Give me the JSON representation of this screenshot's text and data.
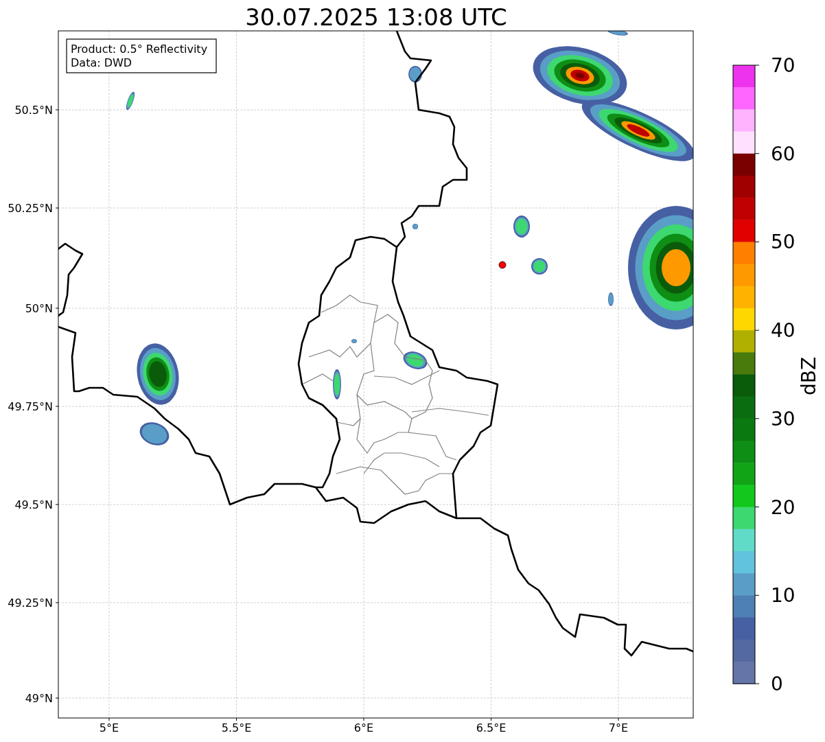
{
  "title": "30.07.2025 13:08 UTC",
  "info_box": [
    "Product: 0.5° Reflectivity",
    "Data: DWD"
  ],
  "map": {
    "x_ticks": [
      "5°E",
      "5.5°E",
      "6°E",
      "6.5°E",
      "7°E"
    ],
    "y_ticks": [
      "50.5°N",
      "50.25°N",
      "50°N",
      "49.75°N",
      "49.5°N",
      "49.25°N",
      "49°N"
    ]
  },
  "colorbar": {
    "label": "dBZ",
    "ticks": [
      "70",
      "60",
      "50",
      "40",
      "30",
      "20",
      "10",
      "0"
    ],
    "levels": [
      {
        "color": "#ee33ee"
      },
      {
        "color": "#ff66ff"
      },
      {
        "color": "#ffb3ff"
      },
      {
        "color": "#ffe0ff"
      },
      {
        "color": "#7a0000"
      },
      {
        "color": "#a00000"
      },
      {
        "color": "#c00000"
      },
      {
        "color": "#e00000"
      },
      {
        "color": "#ff7f00"
      },
      {
        "color": "#ff9900"
      },
      {
        "color": "#ffb300"
      },
      {
        "color": "#ffd700"
      },
      {
        "color": "#b0b000"
      },
      {
        "color": "#487a0c"
      },
      {
        "color": "#0a5c0a"
      },
      {
        "color": "#0a6e10"
      },
      {
        "color": "#0a7a10"
      },
      {
        "color": "#0e8e14"
      },
      {
        "color": "#10a416"
      },
      {
        "color": "#12c81c"
      },
      {
        "color": "#3dd870"
      },
      {
        "color": "#60dbc8"
      },
      {
        "color": "#62c3de"
      },
      {
        "color": "#5a9ec8"
      },
      {
        "color": "#4e7fb5"
      },
      {
        "color": "#4660a3"
      },
      {
        "color": "#5469a0"
      },
      {
        "color": "#6675a8"
      }
    ]
  }
}
